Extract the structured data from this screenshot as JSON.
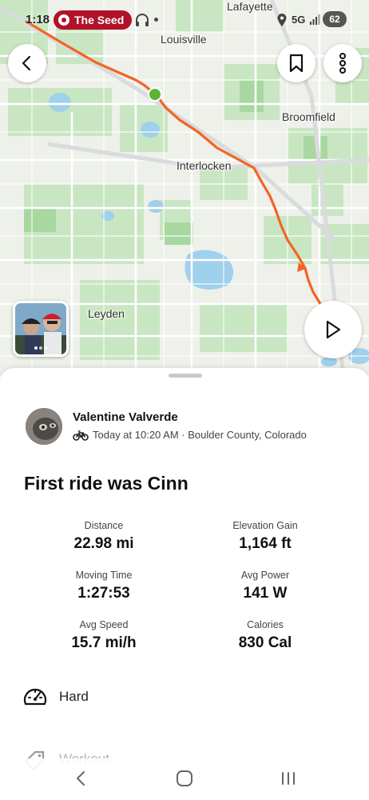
{
  "status_bar": {
    "time": "1:18",
    "notification_pill": "The Seed",
    "network": "5G",
    "battery": "62"
  },
  "map": {
    "places": [
      "Lafayette",
      "Louisville",
      "Broomfield",
      "Interlocken",
      "Leyden"
    ],
    "route_color": "#f26522",
    "start_marker_color": "#5cb335"
  },
  "icons": {
    "back": "chevron-left-icon",
    "bookmark": "bookmark-icon",
    "more": "more-vertical-icon",
    "play": "play-icon",
    "bike": "bike-icon",
    "effort": "speedometer-icon",
    "tag": "tag-icon"
  },
  "activity": {
    "athlete": "Valentine Valverde",
    "meta": "Today at 10:20 AM · Boulder County, Colorado",
    "title": "First ride was Cinn",
    "stats": [
      {
        "label": "Distance",
        "value": "22.98 mi"
      },
      {
        "label": "Elevation Gain",
        "value": "1,164 ft"
      },
      {
        "label": "Moving Time",
        "value": "1:27:53"
      },
      {
        "label": "Avg Power",
        "value": "141 W"
      },
      {
        "label": "Avg Speed",
        "value": "15.7 mi/h"
      },
      {
        "label": "Calories",
        "value": "830 Cal"
      }
    ],
    "perceived_exertion": "Hard",
    "activity_type": "Workout"
  },
  "accent_color": "#fc4c02"
}
